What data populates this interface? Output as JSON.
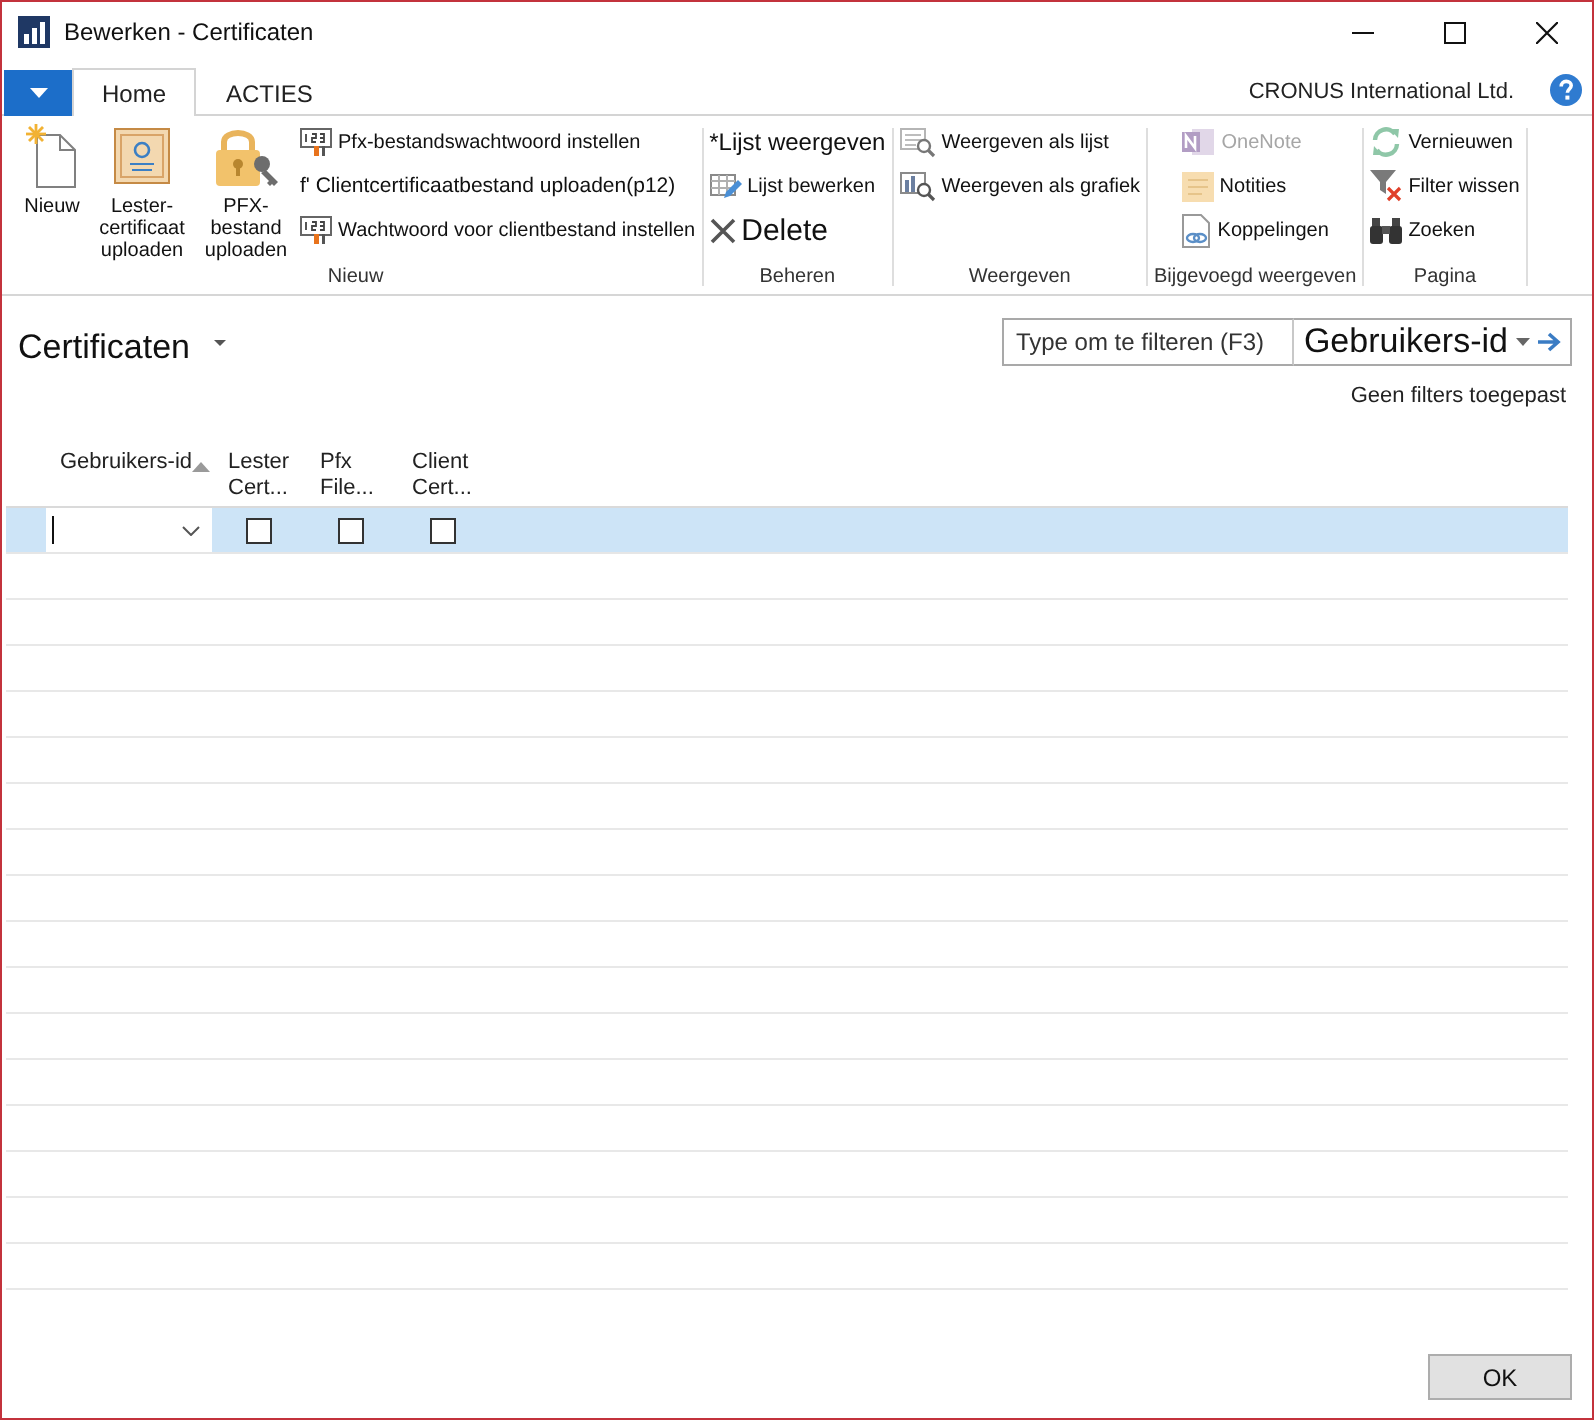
{
  "window": {
    "title": "Bewerken - Certificaten"
  },
  "ribbon": {
    "tabs": [
      {
        "label": "Home",
        "selected": true
      },
      {
        "label": "ACTIES",
        "selected": false
      }
    ],
    "company": "CRONUS International Ltd.",
    "groups": [
      {
        "label": "Nieuw",
        "large_buttons": [
          "Nieuw",
          "Lester-certificaat uploaden",
          "PFX-bestand uploaden"
        ],
        "small_buttons": [
          "Pfx-bestandswachtwoord instellen",
          "f' Clientcertificaatbestand uploaden(p12)",
          "Wachtwoord voor clientbestand instellen"
        ]
      },
      {
        "label": "Beheren",
        "buttons": [
          "*Lijst weergeven",
          "Lijst bewerken",
          "Delete"
        ]
      },
      {
        "label": "Weergeven",
        "buttons": [
          "Weergeven als lijst",
          "Weergeven als grafiek"
        ]
      },
      {
        "label": "Bijgevoegd weergeven",
        "buttons": [
          {
            "label": "OneNote",
            "disabled": true
          },
          {
            "label": "Notities",
            "disabled": false
          },
          {
            "label": "Koppelingen",
            "disabled": false
          }
        ]
      },
      {
        "label": "Pagina",
        "buttons": [
          "Vernieuwen",
          "Filter wissen",
          "Zoeken"
        ]
      }
    ]
  },
  "page": {
    "title": "Certificaten",
    "filter": {
      "placeholder": "Type om te filteren (F3)",
      "field": "Gebruikers-id"
    },
    "filter_status": "Geen filters toegepast"
  },
  "table": {
    "columns": [
      {
        "label": "Gebruikers-id",
        "sorted": true
      },
      {
        "label": "Lester Cert...",
        "sorted": false
      },
      {
        "label": "Pfx File...",
        "sorted": false
      },
      {
        "label": "Client Cert...",
        "sorted": false
      }
    ],
    "rows": [
      {
        "selected": true,
        "checks": [
          false,
          false,
          false
        ]
      }
    ]
  },
  "buttons": [
    "OK"
  ]
}
